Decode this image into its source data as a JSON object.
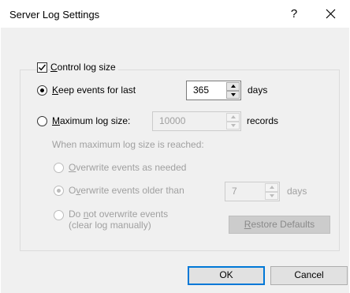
{
  "dialog": {
    "title": "Server Log Settings",
    "help_glyph": "?"
  },
  "control_log_size": {
    "checked": true,
    "label_first": "C",
    "label_rest": "ontrol log size"
  },
  "keep_events": {
    "selected": true,
    "label_first": "K",
    "label_rest": "eep events for last",
    "value": "365",
    "unit": "days"
  },
  "max_log_size": {
    "selected": false,
    "label_first": "M",
    "label_rest": "aximum log size:",
    "value": "10000",
    "unit": "records"
  },
  "when_reached": {
    "text": "When maximum log size is reached:"
  },
  "overwrite_needed": {
    "selected": false,
    "label_first": "O",
    "label_rest": "verwrite events as needed"
  },
  "overwrite_older": {
    "selected": true,
    "label_pre": "O",
    "label_u": "v",
    "label_rest": "erwrite events older than",
    "value": "7",
    "unit": "days"
  },
  "do_not_overwrite": {
    "selected": false,
    "line1_pre": "Do ",
    "line1_u": "n",
    "line1_rest": "ot overwrite events",
    "line2": "(clear log manually)"
  },
  "buttons": {
    "restore_first": "R",
    "restore_rest": "estore Defaults",
    "ok": "OK",
    "cancel": "Cancel"
  },
  "icons": {
    "close": "close-icon",
    "check": "checkmark-icon",
    "spin_up": "spin-up-arrow-icon",
    "spin_down": "spin-down-arrow-icon"
  }
}
